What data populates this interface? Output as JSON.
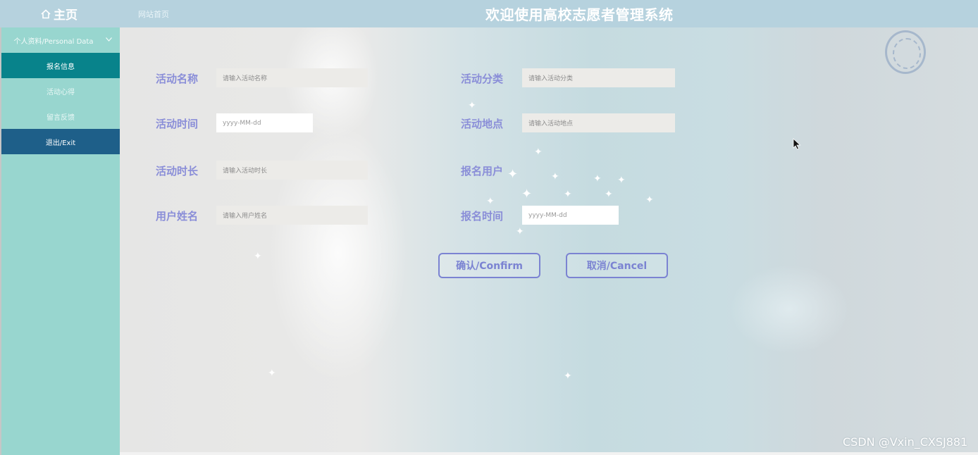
{
  "header": {
    "home_label": "主页",
    "site_link": "网站首页",
    "title": "欢迎使用高校志愿者管理系统"
  },
  "sidebar": {
    "group_label": "个人资料/Personal Data",
    "items": [
      {
        "label": "报名信息"
      },
      {
        "label": "活动心得"
      },
      {
        "label": "留言反馈"
      },
      {
        "label": "退出/Exit"
      }
    ]
  },
  "form": {
    "activity_name": {
      "label": "活动名称",
      "placeholder": "请输入活动名称"
    },
    "activity_category": {
      "label": "活动分类",
      "placeholder": "请输入活动分类"
    },
    "activity_time": {
      "label": "活动时间",
      "placeholder": "yyyy-MM-dd"
    },
    "activity_location": {
      "label": "活动地点",
      "placeholder": "请输入活动地点"
    },
    "activity_duration": {
      "label": "活动时长",
      "placeholder": "请输入活动时长"
    },
    "signup_user": {
      "label": "报名用户"
    },
    "user_name": {
      "label": "用户姓名",
      "placeholder": "请输入用户姓名"
    },
    "signup_time": {
      "label": "报名时间",
      "placeholder": "yyyy-MM-dd"
    },
    "confirm_label": "确认/Confirm",
    "cancel_label": "取消/Cancel"
  },
  "watermark": "CSDN @Vxin_CXSJ881",
  "colors": {
    "topbar": "#b6d2de",
    "sidebar": "#98d6cf",
    "active_item": "#08838b",
    "exit_item": "#1e5f89",
    "label": "#8a8ed8",
    "button_border": "#7b83d2"
  }
}
